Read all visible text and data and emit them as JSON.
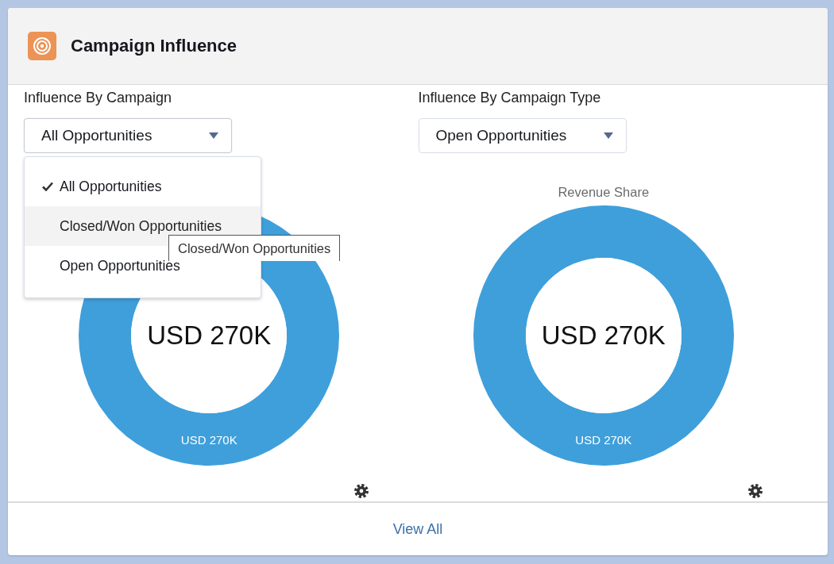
{
  "card": {
    "title": "Campaign Influence"
  },
  "panels": [
    {
      "label": "Influence By Campaign",
      "select": {
        "value": "All Opportunities",
        "open": true,
        "options": [
          {
            "label": "All Opportunities",
            "selected": true,
            "hovered": false
          },
          {
            "label": "Closed/Won Opportunities",
            "selected": false,
            "hovered": true
          },
          {
            "label": "Open Opportunities",
            "selected": false,
            "hovered": false
          }
        ],
        "tooltip": "Closed/Won Opportunities"
      },
      "center_label": "USD 270K",
      "chart_data": {
        "type": "donut",
        "values": [
          100
        ],
        "value_labels": [
          "USD 270K"
        ]
      }
    },
    {
      "label": "Influence By Campaign Type",
      "select": {
        "value": "Open Opportunities",
        "open": false
      },
      "center_label": "USD 270K",
      "chart_data": {
        "type": "donut",
        "title": "Revenue Share",
        "values": [
          100
        ],
        "value_labels": [
          "USD 270K"
        ]
      }
    }
  ],
  "footer": {
    "link": "View All"
  }
}
